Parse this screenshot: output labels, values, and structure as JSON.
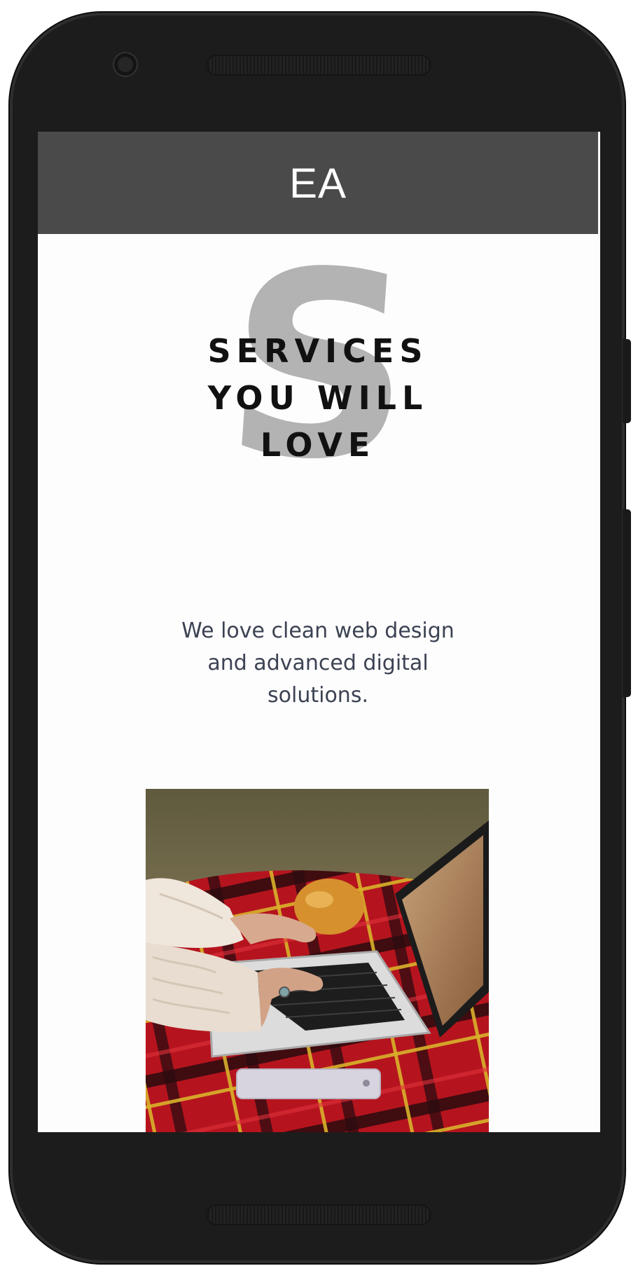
{
  "app": {
    "title": "EA"
  },
  "hero": {
    "decorative_letter": "S",
    "heading_lines": [
      "SERVICES",
      "YOU WILL",
      "LOVE"
    ]
  },
  "tagline": {
    "lines": [
      "We love clean web design",
      "and advanced digital",
      "solutions."
    ]
  },
  "colors": {
    "header_bg": "#4a4a4a",
    "header_text": "#ffffff",
    "decorative_letter": "#b3b3b3",
    "heading_text": "#111111",
    "tagline_text": "#3b4252",
    "device_frame": "#1c1c1c"
  },
  "icons": [
    "front-camera",
    "speaker-grille"
  ]
}
